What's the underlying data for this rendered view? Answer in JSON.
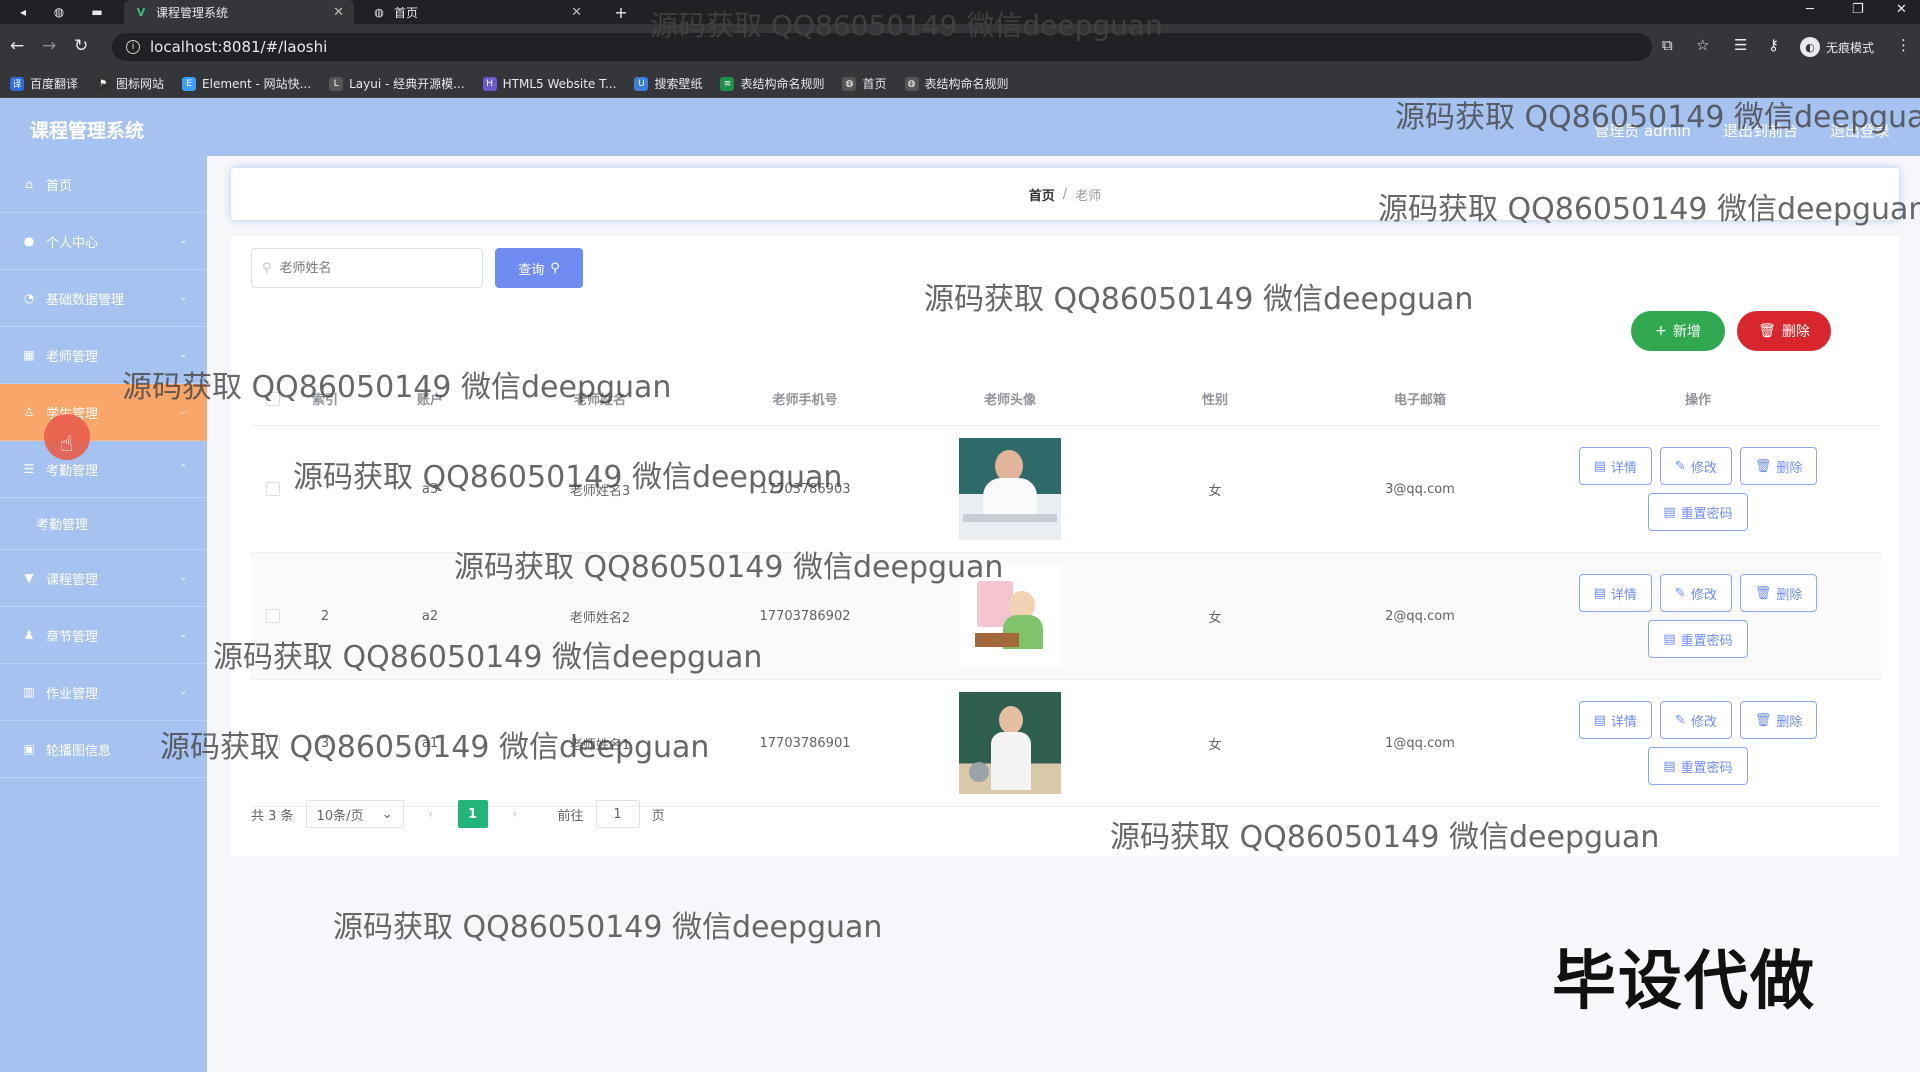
{
  "browser": {
    "tabs": [
      {
        "title": "课程管理系统",
        "active": true
      },
      {
        "title": "首页",
        "active": false
      }
    ],
    "url": "localhost:8081/#/laoshi",
    "incognito_label": "无痕模式",
    "bookmarks": [
      "百度翻译",
      "图标网站",
      "Element - 网站快...",
      "Layui - 经典开源模...",
      "HTML5 Website T...",
      "搜索壁纸",
      "表结构命名规则",
      "首页",
      "表结构命名规则"
    ]
  },
  "app": {
    "title": "课程管理系统",
    "header_links": {
      "admin": "管理员 admin",
      "backend": "退出到前台",
      "logout": "退出登录"
    }
  },
  "sidebar": {
    "items": [
      {
        "label": "首页",
        "icon": "home-icon"
      },
      {
        "label": "个人中心",
        "icon": "user-icon"
      },
      {
        "label": "基础数据管理",
        "icon": "data-icon"
      },
      {
        "label": "老师管理",
        "icon": "teacher-icon"
      },
      {
        "label": "学生管理",
        "icon": "student-icon",
        "active": true
      },
      {
        "label": "考勤管理",
        "icon": "attendance-icon"
      },
      {
        "label": "课程管理",
        "icon": "course-icon"
      },
      {
        "label": "章节管理",
        "icon": "chapter-icon"
      },
      {
        "label": "作业管理",
        "icon": "homework-icon"
      },
      {
        "label": "轮播图信息",
        "icon": "carousel-icon"
      }
    ],
    "subitem": "考勤管理"
  },
  "breadcrumb": {
    "home": "首页",
    "sep": "/",
    "current": "老师"
  },
  "toolbar": {
    "search_placeholder": "老师姓名",
    "query_label": "查询",
    "add_label": "新增",
    "delete_label": "删除"
  },
  "table": {
    "headers": [
      "索引",
      "账户",
      "老师姓名",
      "老师手机号",
      "老师头像",
      "性别",
      "电子邮箱",
      "操作"
    ],
    "rows": [
      {
        "index": "",
        "account": "a3",
        "name": "老师姓名3",
        "phone": "17703786903",
        "gender": "女",
        "email": "3@qq.com"
      },
      {
        "index": "2",
        "account": "a2",
        "name": "老师姓名2",
        "phone": "17703786902",
        "gender": "女",
        "email": "2@qq.com"
      },
      {
        "index": "3",
        "account": "a1",
        "name": "老师姓名1",
        "phone": "17703786901",
        "gender": "女",
        "email": "1@qq.com"
      }
    ],
    "ops": {
      "detail": "详情",
      "edit": "修改",
      "delete": "删除",
      "reset": "重置密码"
    }
  },
  "pager": {
    "total": "共 3 条",
    "page_size": "10条/页",
    "current": "1",
    "goto_prefix": "前往",
    "goto_value": "1",
    "goto_suffix": "页"
  },
  "overlay": {
    "watermark": "源码获取 QQ86050149 微信deepguan",
    "stamp": "毕设代做"
  },
  "colors": {
    "sidebar": "#a5c2f0",
    "active_menu": "#f8a66a",
    "primary": "#6f8cf2",
    "success": "#2fa84f",
    "danger": "#d9262c",
    "page_active": "#22b57a"
  }
}
